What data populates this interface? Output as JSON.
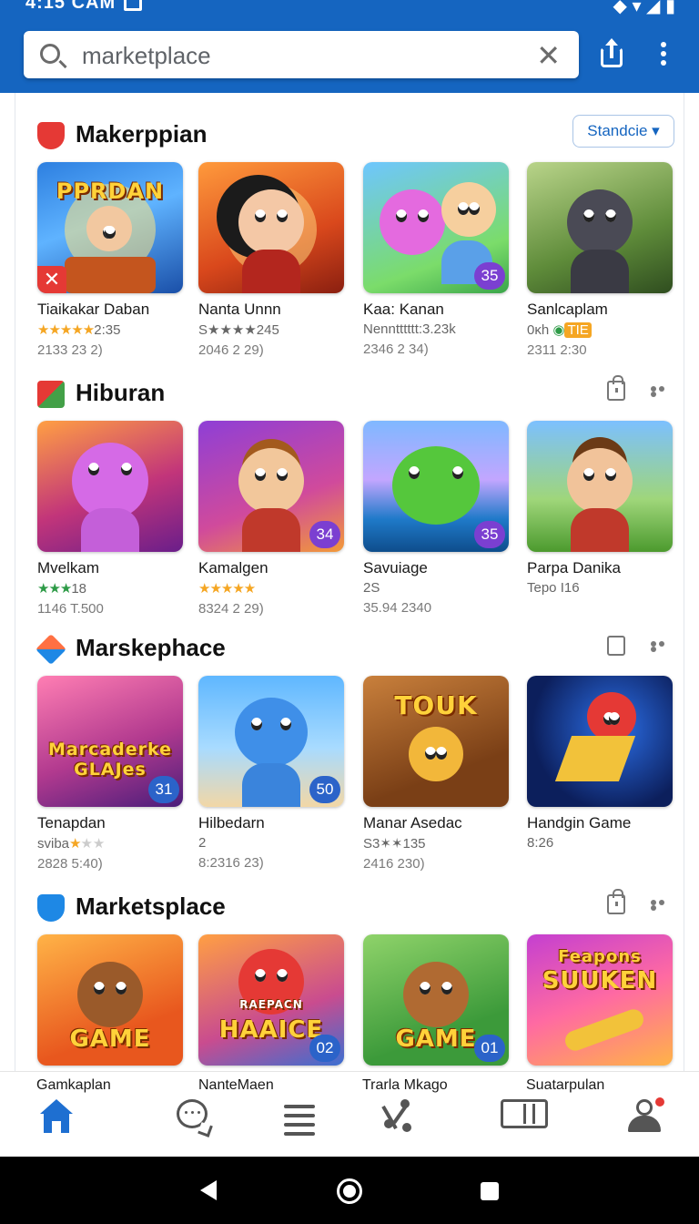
{
  "status_bar": {
    "time": "4:15 CAM"
  },
  "search": {
    "query": "marketplace"
  },
  "sections": [
    {
      "title": "Makerppian",
      "sort_label": "Standcie",
      "tiles": [
        {
          "art_title": "PPRDAN",
          "name": "Tiaikakar Daban",
          "rating_text": "2:35",
          "meta": "2133 23 2)"
        },
        {
          "name": "Nanta Unnn",
          "rating_text": "S★★★★245",
          "meta": "2046 2 29)"
        },
        {
          "badge": "35",
          "name": "Kaa: Kanan",
          "rating_text": "Nenntttttt:3.23k",
          "meta": "2346 2 34)"
        },
        {
          "name": "Sanlcaplam",
          "rating_text": "0ĸh",
          "rating_tag": "TIE",
          "meta": "2311 2:30"
        }
      ]
    },
    {
      "title": "Hiburan",
      "tiles": [
        {
          "name": "Mvelkam",
          "rating_text": "18",
          "meta": "1146 T.500"
        },
        {
          "badge": "34",
          "name": "Kamalgen",
          "meta": "8324 2 29)"
        },
        {
          "badge": "35",
          "name": "Savuiage",
          "rating_text": "2S",
          "meta": "35.94 2340"
        },
        {
          "name": "Parpa Danika",
          "rating_text": "Tepo I16"
        }
      ]
    },
    {
      "title": "Marskephace",
      "tiles": [
        {
          "art_title": "Marcaderke GLAJes",
          "badge": "31",
          "name": "Tenapdan",
          "rating_text": "sviba",
          "meta": "2828 5:40)"
        },
        {
          "badge": "50",
          "name": "Hilbedarn",
          "rating_text": "2",
          "meta": "8:2316 23)"
        },
        {
          "art_title": "TOUK",
          "name": "Manar Asedac",
          "rating_text": "S3✶✶135",
          "meta": "2416 230)"
        },
        {
          "name": "Handgin Game",
          "rating_text": "8:26"
        }
      ]
    },
    {
      "title": "Marketsplace",
      "tiles": [
        {
          "art_title": "GAME"
        },
        {
          "art_title": "HAAICE",
          "art_subtitle": "RAEPACN",
          "badge": "02"
        },
        {
          "art_title": "GAME",
          "badge": "01"
        },
        {
          "art_title": "SUUKEN",
          "art_subtitle": "Feapons"
        }
      ]
    }
  ],
  "bottom_nav": {
    "labels": [
      "Gamkaplan",
      "NanteMaen",
      "Trarla Mkago",
      "Suatarpulan"
    ],
    "icons": [
      "home-icon",
      "chat-icon",
      "list-icon",
      "branch-icon",
      "book-icon",
      "profile-icon"
    ]
  },
  "colors": {
    "header": "#1565c0",
    "accent": "#1e6fd1",
    "badge_blue": "#2b63c9",
    "badge_purple": "#7b3fd1"
  }
}
